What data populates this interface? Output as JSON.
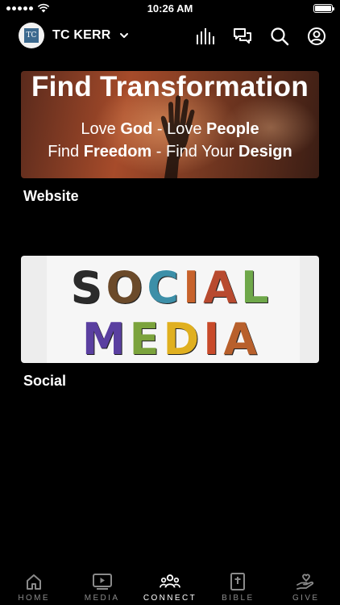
{
  "status_bar": {
    "time": "10:26 AM"
  },
  "header": {
    "church_name": "TC KERR",
    "logo_text": "TC"
  },
  "cards": [
    {
      "title": "Website",
      "banner": {
        "headline": "Find Transformation",
        "line1_parts": [
          "Love ",
          "God",
          " - Love ",
          "People"
        ],
        "line2_parts": [
          "Find ",
          "Freedom",
          " - Find Your ",
          "Design"
        ]
      }
    },
    {
      "title": "Social",
      "banner": {
        "word1": "SOCIAL",
        "word2": "MEDIA"
      }
    }
  ],
  "tabs": [
    {
      "label": "HOME",
      "icon": "home-icon",
      "active": false
    },
    {
      "label": "MEDIA",
      "icon": "play-icon",
      "active": false
    },
    {
      "label": "CONNECT",
      "icon": "people-icon",
      "active": true
    },
    {
      "label": "BIBLE",
      "icon": "bible-icon",
      "active": false
    },
    {
      "label": "GIVE",
      "icon": "give-icon",
      "active": false
    }
  ],
  "colors": {
    "background": "#000000",
    "active_tab": "#ffffff",
    "inactive_tab": "#8a8a8a"
  }
}
